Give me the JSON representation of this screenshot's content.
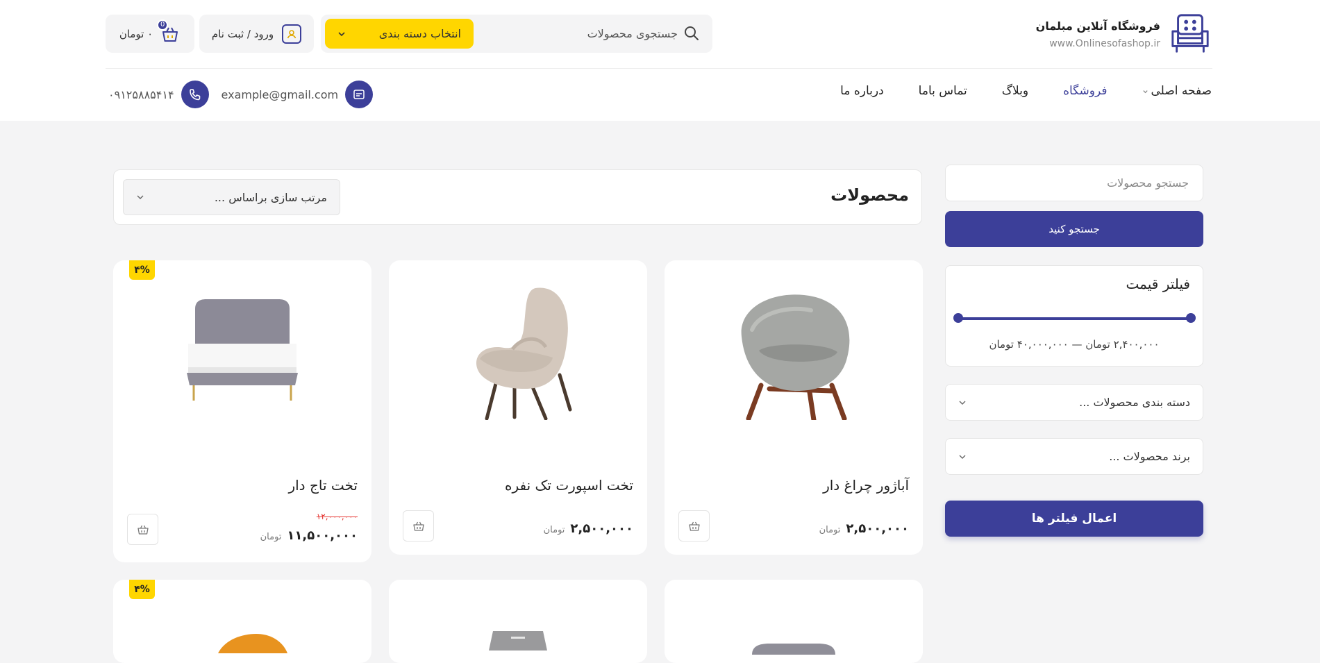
{
  "brand": {
    "name": "فروشگاه آنلاین مبلمان",
    "url": "www.Onlinesofashop.ir"
  },
  "search": {
    "placeholder": "جستجوی محصولات",
    "category_label": "انتخاب دسته بندی"
  },
  "account": {
    "login_label": "ورود / ثبت نام"
  },
  "cart": {
    "total_label": "۰ تومان",
    "count": "0"
  },
  "nav": {
    "items": [
      {
        "label": "صفحه اصلی"
      },
      {
        "label": "فروشگاه"
      },
      {
        "label": "وبلاگ"
      },
      {
        "label": "تماس باما"
      },
      {
        "label": "درباره ما"
      }
    ]
  },
  "contact": {
    "email": "example@gmail.com",
    "phone": "۰۹۱۲۵۸۸۵۴۱۴"
  },
  "sidebar": {
    "search_placeholder": "جستجو محصولات",
    "search_button": "جستجو کنید",
    "price_filter_title": "فیلتر قیمت",
    "price_range": "۲,۴۰۰,۰۰۰ تومان — ۴۰,۰۰۰,۰۰۰ تومان",
    "category_select": "دسته بندی محصولات ...",
    "brand_select": "برند محصولات ...",
    "apply_button": "اعمال فیلتر ها"
  },
  "products_header": {
    "title": "محصولات",
    "sort_label": "مرتب سازی براساس ..."
  },
  "products": [
    {
      "name": "آباژور چراغ دار",
      "price": "۲,۵۰۰,۰۰۰",
      "currency": "تومان"
    },
    {
      "name": "تخت اسپورت تک نفره",
      "price": "۲,۵۰۰,۰۰۰",
      "currency": "تومان"
    },
    {
      "name": "تخت تاج دار",
      "price": "۱۱,۵۰۰,۰۰۰",
      "old_price": "۱۲,۰۰۰,۰۰۰",
      "currency": "تومان",
      "discount": "۴%"
    }
  ],
  "products_row2": [
    {
      "discount": "۴%"
    }
  ],
  "colors": {
    "primary": "#3c3f99",
    "accent": "#ffd600",
    "discount_old_price": "#e53935"
  }
}
